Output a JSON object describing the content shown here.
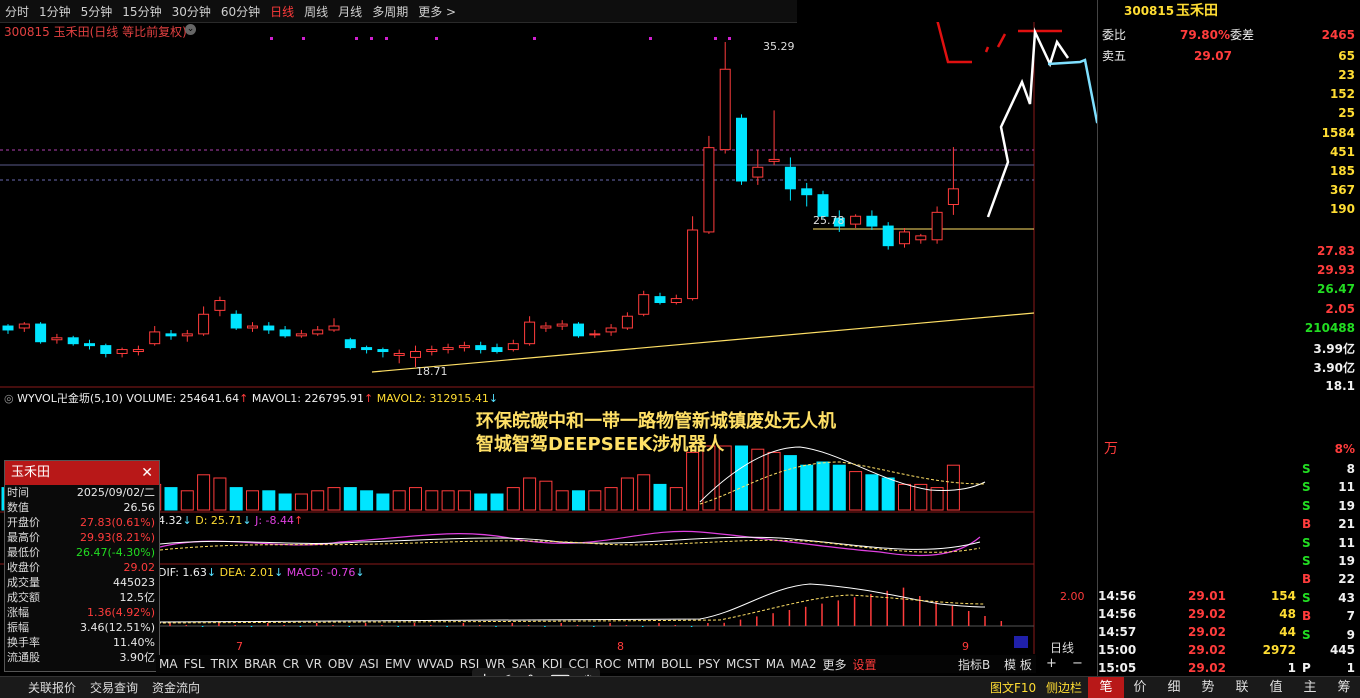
{
  "toolbar": {
    "periods": [
      "分时",
      "1分钟",
      "5分钟",
      "15分钟",
      "30分钟",
      "60分钟",
      "日线",
      "周线",
      "月线",
      "多周期",
      "更多 >"
    ],
    "active": "日线"
  },
  "chart": {
    "title": "300815 玉禾田(日线 等比前复权)",
    "high_label": "35.29",
    "mid_label": "25.78",
    "low_label": "18.71",
    "vol_legend": {
      "name": "WYVOL卍金坜(5,10)",
      "volume": "VOLUME: 254641.64",
      "mavol1": "MAVOL1: 226795.91",
      "mavol2": "MAVOL2: 312915.41"
    },
    "kdj_legend": {
      "k": "4.32",
      "d": "D: 25.71",
      "j": "J: -8.44"
    },
    "macd_legend": {
      "dif": "DIF: 1.63",
      "dea": "DEA: 2.01",
      "macd": "MACD: -0.76"
    },
    "macd_axis": "2.00",
    "month_labels": [
      "7",
      "8",
      "9"
    ],
    "concept_line1": "环保皖碳中和一带一路物管新城镇废处无人机",
    "concept_line2": "智城智驾DEEPSEEK涉机器人"
  },
  "info_box": {
    "title": "玉禾田",
    "rows": [
      {
        "k": "时间",
        "v": "2025/09/02/二",
        "c": "white"
      },
      {
        "k": "数值",
        "v": "26.56",
        "c": "white"
      },
      {
        "k": "开盘价",
        "v": "27.83(0.61%)",
        "c": "red"
      },
      {
        "k": "最高价",
        "v": "29.93(8.21%)",
        "c": "red"
      },
      {
        "k": "最低价",
        "v": "26.47(-4.30%)",
        "c": "green"
      },
      {
        "k": "收盘价",
        "v": "29.02",
        "c": "red"
      },
      {
        "k": "成交量",
        "v": "445023",
        "c": "white"
      },
      {
        "k": "成交额",
        "v": "12.5亿",
        "c": "white"
      },
      {
        "k": "涨幅",
        "v": "1.36(4.92%)",
        "c": "red"
      },
      {
        "k": "振幅",
        "v": "3.46(12.51%)",
        "c": "white"
      },
      {
        "k": "换手率",
        "v": "11.40%",
        "c": "white"
      },
      {
        "k": "流通股",
        "v": "3.90亿",
        "c": "white"
      }
    ]
  },
  "indicators": {
    "items": [
      "MA",
      "FSL",
      "TRIX",
      "BRAR",
      "CR",
      "VR",
      "OBV",
      "ASI",
      "EMV",
      "WVAD",
      "RSI",
      "WR",
      "SAR",
      "KDJ",
      "CCI",
      "ROC",
      "MTM",
      "BOLL",
      "PSY",
      "MCST",
      "MA",
      "MA2",
      "更多",
      "设置"
    ],
    "right": [
      "指标B",
      "模 板"
    ],
    "timeframe": "日线"
  },
  "right_panel": {
    "code": "300815",
    "name": "玉禾田",
    "webi_label": "委比",
    "webi": "79.80%",
    "weicha_label": "委差",
    "weicha": "2465",
    "sell5_label": "卖五",
    "sell5": "29.07",
    "book_vols": [
      "65",
      "23",
      "152",
      "25",
      "1584",
      "451",
      "185",
      "367",
      "190"
    ],
    "prices": [
      {
        "v": "27.83",
        "c": "red"
      },
      {
        "v": "29.93",
        "c": "red"
      },
      {
        "v": "26.47",
        "c": "green"
      },
      {
        "v": "2.05",
        "c": "red"
      },
      {
        "v": "210488",
        "c": "green"
      }
    ],
    "amounts": [
      "3.99亿",
      "3.90亿",
      "18.1"
    ],
    "wan_label": "万",
    "pct": "8%",
    "bs": [
      {
        "t": "S",
        "v": "8"
      },
      {
        "t": "S",
        "v": "11"
      },
      {
        "t": "S",
        "v": "19"
      },
      {
        "t": "B",
        "v": "21"
      },
      {
        "t": "S",
        "v": "11"
      },
      {
        "t": "S",
        "v": "19"
      },
      {
        "t": "B",
        "v": "22"
      },
      {
        "t": "S",
        "v": "43"
      },
      {
        "t": "B",
        "v": "7"
      },
      {
        "t": "S",
        "v": "9"
      },
      {
        "t": "P",
        "v": "1"
      }
    ],
    "ticks": [
      {
        "time": "14:56",
        "price": "29.01",
        "vol": "154",
        "c": "yel"
      },
      {
        "time": "14:56",
        "price": "29.02",
        "vol": "48",
        "c": "yel"
      },
      {
        "time": "14:57",
        "price": "29.02",
        "vol": "44",
        "c": "yel"
      },
      {
        "time": "15:00",
        "price": "29.02",
        "vol": "2972",
        "c": "yel"
      },
      {
        "time": "15:05",
        "price": "29.02",
        "vol": "1",
        "c": "white"
      }
    ],
    "tick_total": "445"
  },
  "bottom": {
    "left": [
      "关联报价",
      "交易查询",
      "资金流向"
    ],
    "right": [
      "图文F10",
      "侧边栏"
    ],
    "tabs": [
      "笔",
      "价",
      "细",
      "势",
      "联",
      "值",
      "主",
      "筹"
    ],
    "active_tab": "笔"
  }
}
